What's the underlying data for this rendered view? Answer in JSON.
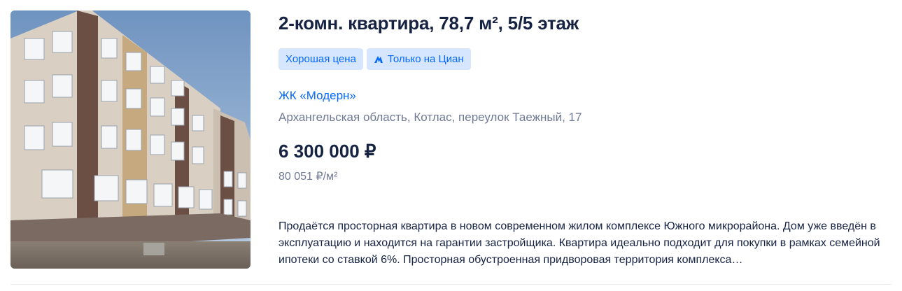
{
  "listing": {
    "photo": {
      "icon": "building-photo",
      "alt": ""
    },
    "title": "2-комн. квартира, 78,7 м², 5/5 этаж",
    "badges": [
      {
        "label": "Хорошая цена",
        "icon": ""
      },
      {
        "label": "Только на Циан",
        "icon": "cian-logo-icon"
      }
    ],
    "complex_name": "ЖК «Модерн»",
    "address": "Архангельская область, Котлас, переулок Таежный, 17",
    "price": "6 300 000 ₽",
    "price_per_meter": "80 051 ₽/м²",
    "description": "Продаётся просторная квартира в новом современном жилом комплексе Южного микрорайона. Дом уже введён в эксплуатацию и находится на гарантии застройщика. Квартира идеально подходит для покупки в рамках семейной ипотеки со ставкой 6%. Просторная обустроенная придворовая территория комплекса…"
  },
  "colors": {
    "title": "#152242",
    "link": "#0468ff",
    "badge_bg": "#d6e6ff",
    "muted": "#707a95"
  }
}
